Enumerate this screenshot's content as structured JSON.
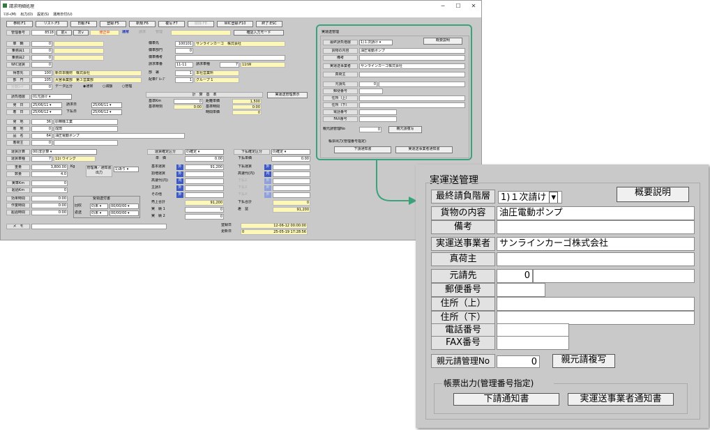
{
  "window": {
    "title": "請求明細処理",
    "min": "─",
    "max": "☐",
    "close": "✕"
  },
  "menu": [
    "ﾏｽﾀｰ(M)",
    "出力(O)",
    "設定(S)",
    "運用日付(U)"
  ],
  "toolbar": [
    "参照:F1",
    "リスト:F3",
    "日報:F4",
    "登録:F5",
    "新規:F6",
    "複写:F7",
    "削除:F8",
    "WIC登録:F10",
    "終了:ESC"
  ],
  "header": {
    "mgmt_label": "管理番号",
    "mgmt_no": "8518",
    "prev": "前∧",
    "next": "次∨",
    "status": "修正中",
    "mode": "通常",
    "tab_invoice": "請求",
    "tab_manage": "管理",
    "confirm_mode": "確認入力モード"
  },
  "left": {
    "sharyo_label": "車　輌",
    "sharyo": "0",
    "jyo1_label": "乗務員1",
    "jyo1": "0",
    "jyo2_label": "乗務員2",
    "jyo2": "0",
    "wic_label": "WIC運賃",
    "wic": "0",
    "tokui_label": "得意先",
    "tokui_code": "100",
    "tokui_name": "新日本機材　株式会社",
    "bumon_label": "部　門",
    "bumon_code": "105",
    "bumon_name": "大宮事業部　第３営業部",
    "bunkatsu_label": "分割ｺｰﾄﾞ",
    "bunkatsu": "0",
    "data_kubun": "データ区分",
    "radio1": "通常",
    "radio2": "減額",
    "radio3": "管理",
    "ukeoi_label": "請負階層",
    "ukeoi": "01元請け",
    "hatsu_label": "発　日",
    "hatsu": "25/06/11",
    "seikyu_label": "請求日",
    "seikyu": "25/06/11",
    "chaku_label": "着　日",
    "chaku": "25/06/12",
    "shiharai_label": "下払日",
    "shiharai": "25/06/12",
    "hatchi_label": "発　地",
    "hatchi_code": "36",
    "hatchi": "原精機工業",
    "chakuchi_label": "着　地",
    "chakuchi_code": "0",
    "chakuchi": "成田",
    "hinmei_label": "品　名",
    "hinmei_code": "64",
    "hinmei": "油圧電動ポンプ",
    "nini_label": "着荷主",
    "nini": "0",
    "keisan_label": "運賃計算",
    "keisan": "00)非計算",
    "shashu_label": "運賃車種",
    "shashu_code": "7",
    "shashu": "11t ウイング",
    "juryo_label": "重量",
    "juryo": "3,800.00",
    "juryo_unit": "Kg",
    "suryo_label": "数量",
    "suryo": "4.0",
    "kanri_label": "管理簿／通知書出力",
    "kanri": "1)あり",
    "jissha_label": "実車Km",
    "jissha": "0",
    "choka_label": "超過Km",
    "choka": "0",
    "koka_label": "効果時間",
    "koka": "0:00",
    "sagyo_label": "作業時間",
    "sagyo": "0:00",
    "chokaji_label": "超過時間",
    "chokaji": "0:00",
    "juryo_box": "受領送付書",
    "kaishu": "回収",
    "kaishu_v": "0)未",
    "kaishu_d": "00/00/00",
    "henso": "返送",
    "henso_v": "0)未",
    "henso_d": "00/00/00",
    "memo_label": "メ　モ"
  },
  "middle": {
    "bisha_label": "傭車先",
    "bisha_code": "100101",
    "bisha": "サンラインカーゴ　株式会社",
    "bbumon_label": "傭車部門",
    "bbumon": "0",
    "bbiko_label": "傭車備考",
    "shaban_label": "請求車番",
    "shaban": "11-11",
    "shashu_label": "請求車種",
    "shashu_code": "7",
    "shashu": "11tW",
    "busho_label": "部　署",
    "busho_code": "1",
    "busho": "本社営業所",
    "haisha_label": "配車ｸﾞﾙｰﾌﾟ",
    "haisha_code": "1",
    "haisha": "グループ 1",
    "keisan_hdr": "計　算　基　準",
    "kijun_km_label": "基準Km",
    "kijun_km": "0",
    "kyori_label": "距離単価",
    "kyori": "1,500",
    "kijun_ji_label": "基準時刻",
    "kijun_ji": "0:00",
    "kijun_jikan_label": "基準時間",
    "kijun_jikan": "0:00",
    "jikan_tanka_label": "時間単価",
    "jikan_tanka": "0",
    "kakutei_label": "運賃確定区分",
    "kakutei": "0)確定",
    "tanka_label": "単　価",
    "tanka": "0.00",
    "kihon_label": "基本運賃",
    "kihon": "91,200",
    "warimashi_label": "割増運賃",
    "kosoku_label": "高速代(内)",
    "nushi_label": "主請3",
    "sonota_label": "その他",
    "uriage_label": "売上合計",
    "uriage": "91,200",
    "jitsu1_label": "実　績 1",
    "jitsu1": "0",
    "jitsu2_label": "実　績 2",
    "jitsu2": "0",
    "soto": "外",
    "uchi": "内",
    "sbtn": "実運送管理表示"
  },
  "right": {
    "kakutei_label": "下払確定区分",
    "kakutei": "0)確定",
    "tanka_label": "下払単価",
    "tanka": "0.00",
    "unchin_label": "下払運賃",
    "kosoku_label": "高速代(内)",
    "h2": "下払2",
    "h3": "下払3",
    "h4": "下払4",
    "gokei_label": "下払合計",
    "gokei": "0",
    "saeki_label": "差　益",
    "saeki": "91,200",
    "toroku_label": "登録日",
    "toroku": "12-06-12 00:00:00",
    "koshin_label": "更新日",
    "koshin_code": "0",
    "koshin": "25-05-19 17:28:56"
  },
  "panel": {
    "title": "実運送管理",
    "kaiso_label": "最終請負階層",
    "kaiso": "1)１次請け",
    "setsumei": "概要説明",
    "kamotsu_label": "貨物の内容",
    "kamotsu": "油圧電動ポンプ",
    "biko_label": "備考",
    "biko": "",
    "jigyosha_label": "実運送事業者",
    "jigyosha": "サンラインカーゴ株式会社",
    "shinninushi_label": "真荷主",
    "shinninushi": "",
    "motouke_label": "元請先",
    "motouke": "0",
    "yubin_label": "郵便番号",
    "jusho1_label": "住所（上）",
    "jusho2_label": "住所（下）",
    "denwa_label": "電話番号",
    "fax_label": "FAX番号",
    "oya_label": "親元請管理No",
    "oya": "0",
    "fukusha": "親元請複写",
    "chohyo_label": "帳票出力(管理番号指定)",
    "tsuchi1": "下請通知書",
    "tsuchi2": "実運送事業者通知書"
  },
  "colors": {
    "accent": "#3aa37a",
    "yellow": "#fdf8b8",
    "blue": "#3d59c4",
    "status_red": "#e0202a"
  }
}
